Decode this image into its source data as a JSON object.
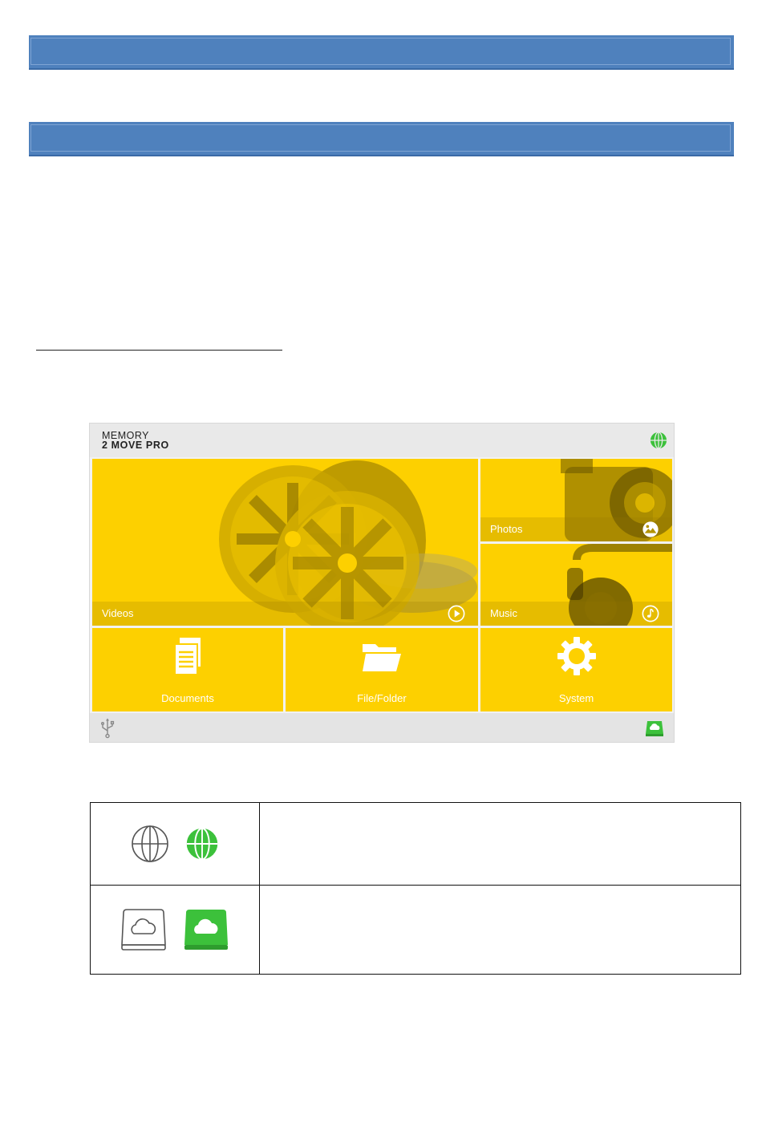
{
  "app": {
    "logo_line1": "MEMORY",
    "logo_line2": "2 MOVE PRO",
    "top_status_icon": "globe-icon",
    "bottom_left_icon": "usb-icon",
    "bottom_right_icon": "cloud-drive-icon",
    "tiles": {
      "videos": "Videos",
      "photos": "Photos",
      "music": "Music",
      "documents": "Documents",
      "file_folder": "File/Folder",
      "system": "System"
    }
  },
  "legend": {
    "row1_icons": [
      "globe-outline-icon",
      "globe-green-icon"
    ],
    "row2_icons": [
      "cloud-drive-outline-icon",
      "cloud-drive-green-icon"
    ]
  },
  "colors": {
    "header_bar": "#4f81bd",
    "tile_yellow": "#fdd000",
    "status_green": "#3cc13b"
  }
}
